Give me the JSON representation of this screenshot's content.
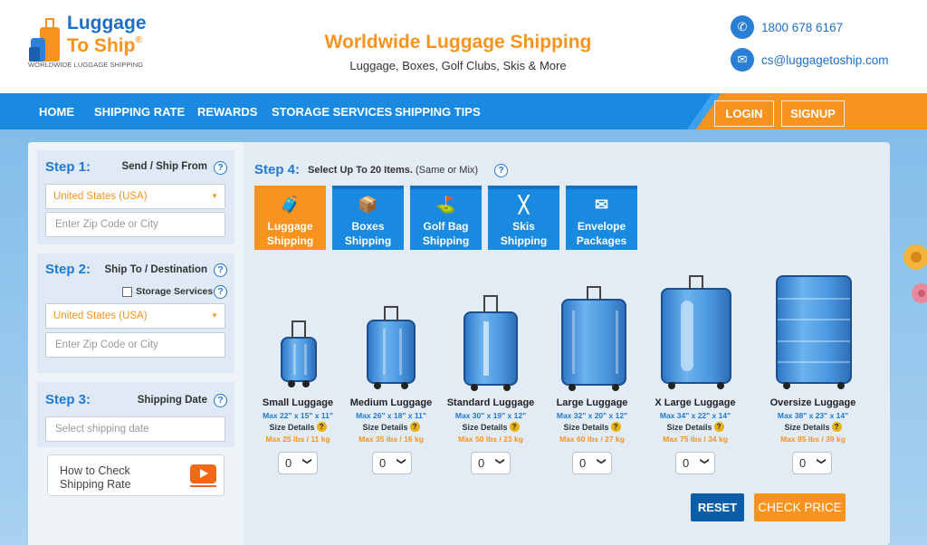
{
  "brand": {
    "line1": "Luggage",
    "line2": "To Ship",
    "reg": "®",
    "tagline": "WORLDWIDE LUGGAGE SHIPPING"
  },
  "header": {
    "title": "Worldwide Luggage Shipping",
    "subtitle": "Luggage, Boxes, Golf Clubs, Skis & More"
  },
  "contact": {
    "phone": "1800 678 6167",
    "email": "cs@luggagetoship.com",
    "phone_icon": "phone-icon",
    "email_icon": "mail-icon"
  },
  "nav": {
    "items": [
      "HOME",
      "SHIPPING RATE",
      "REWARDS",
      "STORAGE SERVICES",
      "SHIPPING TIPS"
    ],
    "login": "LOGIN",
    "signup": "SIGNUP"
  },
  "step1": {
    "heading": "Step 1:",
    "label": "Send / Ship From",
    "country": "United States (USA)",
    "zip_placeholder": "Enter Zip Code or City"
  },
  "step2": {
    "heading": "Step 2:",
    "label": "Ship To / Destination",
    "storage_label": "Storage Services",
    "country": "United States (USA)",
    "zip_placeholder": "Enter Zip Code or City"
  },
  "step3": {
    "heading": "Step 3:",
    "label": "Shipping Date",
    "date_placeholder": "Select shipping date"
  },
  "howto": {
    "line1": "How to Check",
    "line2": "Shipping Rate"
  },
  "step4": {
    "heading": "Step 4:",
    "text": "Select Up To 20 Items.",
    "note": "(Same or Mix)",
    "tabs": [
      {
        "line1": "Luggage",
        "line2": "Shipping",
        "icon": "luggage-icon",
        "glyph": "🧳",
        "active": true
      },
      {
        "line1": "Boxes",
        "line2": "Shipping",
        "icon": "box-icon",
        "glyph": "📦",
        "active": false
      },
      {
        "line1": "Golf Bag",
        "line2": "Shipping",
        "icon": "golf-bag-icon",
        "glyph": "⛳",
        "active": false
      },
      {
        "line1": "Skis",
        "line2": "Shipping",
        "icon": "skis-icon",
        "glyph": "╳",
        "active": false
      },
      {
        "line1": "Envelope",
        "line2": "Packages",
        "icon": "envelope-icon",
        "glyph": "✉",
        "active": false
      }
    ]
  },
  "products": [
    {
      "name": "Small Luggage",
      "max": "Max 22\" x 15\" x 11\"",
      "details": "Size Details",
      "weight": "Max 25 lbs / 11 kg",
      "qty": "0"
    },
    {
      "name": "Medium Luggage",
      "max": "Max 26\" x 18\" x 11\"",
      "details": "Size Details",
      "weight": "Max 35 lbs / 16 kg",
      "qty": "0"
    },
    {
      "name": "Standard Luggage",
      "max": "Max 30\" x 19\" x 12\"",
      "details": "Size Details",
      "weight": "Max 50 lbs / 23 kg",
      "qty": "0"
    },
    {
      "name": "Large Luggage",
      "max": "Max 32\" x 20\" x 12\"",
      "details": "Size Details",
      "weight": "Max 60 lbs / 27 kg",
      "qty": "0"
    },
    {
      "name": "X Large Luggage",
      "max": "Max 34\" x 22\" x 14\"",
      "details": "Size Details",
      "weight": "Max 75 lbs / 34 kg",
      "qty": "0"
    },
    {
      "name": "Oversize Luggage",
      "max": "Max 38\" x 23\" x 14\"",
      "details": "Size Details",
      "weight": "Max 85 lbs / 39 kg",
      "qty": "0"
    }
  ],
  "actions": {
    "reset": "RESET",
    "check": "CHECK PRICE"
  },
  "colors": {
    "accent_orange": "#f7931e",
    "brand_blue": "#1a8ae0",
    "dark_blue": "#0b5da8"
  }
}
